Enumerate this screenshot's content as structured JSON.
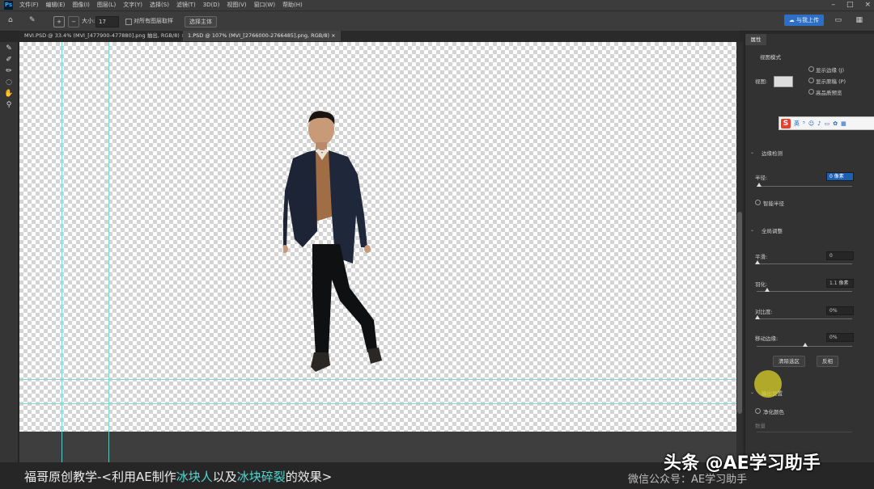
{
  "menubar": {
    "items": [
      "文件(F)",
      "编辑(E)",
      "图像(I)",
      "图层(L)",
      "文字(Y)",
      "选择(S)",
      "滤镜(T)",
      "3D(D)",
      "视图(V)",
      "窗口(W)",
      "帮助(H)"
    ]
  },
  "options": {
    "size_label": "大小:",
    "size_value": "17",
    "sample_all_label": "对所有图层取样",
    "select_subject_label": "选择主体",
    "share_label": "与我上传"
  },
  "tabs": [
    {
      "label": "MVI.PSD @ 33.4% (MVI_[477900-477880].png 抽出, RGB/8) ×"
    },
    {
      "label": "1.PSD @ 107% (MVI_[2766000-2766485].png, RGB/8) ×"
    }
  ],
  "panel": {
    "tab_label": "属性",
    "view_mode_title": "视图模式",
    "view_label": "视图:",
    "show_edge_label": "显示边缘 (J)",
    "show_original_label": "显示原稿 (P)",
    "hq_preview_label": "高品质预览",
    "edge_detection_title": "边缘检测",
    "radius_label": "半径:",
    "radius_value": "0 像素",
    "smart_radius_label": "智能半径",
    "global_refine_title": "全局调整",
    "smooth_label": "平滑:",
    "smooth_value": "0",
    "feather_label": "羽化:",
    "feather_value": "1.1 像素",
    "contrast_label": "对比度:",
    "contrast_value": "0%",
    "shift_edge_label": "移动边缘:",
    "shift_edge_value": "0%",
    "clear_selection_label": "清除选区",
    "invert_label": "反相",
    "output_title": "输出设置",
    "decontaminate_label": "净化颜色",
    "amount_label": "数量"
  },
  "ime": {
    "logo": "S",
    "lang": "英"
  },
  "caption": {
    "prefix": "福哥原创教学-<利用AE制作",
    "hl1": "冰块人",
    "mid": "以及",
    "hl2": "冰块碎裂",
    "suffix": "的效果>",
    "right": "微信公众号：AE学习助手"
  },
  "watermark": "头条 @AE学习助手",
  "colors": {
    "accent": "#1d5fb3",
    "guide": "#6fd6d6",
    "caption_highlight": "#4fd8d0"
  }
}
